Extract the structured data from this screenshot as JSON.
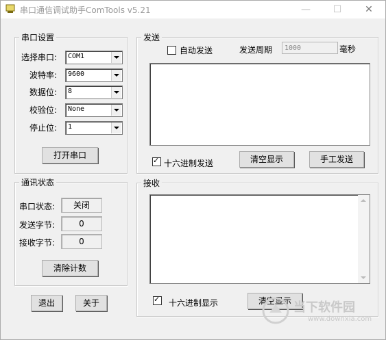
{
  "window": {
    "title": "串口通信调试助手ComTools v5.21"
  },
  "serial": {
    "title": "串口设置",
    "port": {
      "label": "选择串口:",
      "value": "COM1"
    },
    "baud": {
      "label": "波特率:",
      "value": "9600"
    },
    "databits": {
      "label": "数据位:",
      "value": "8"
    },
    "parity": {
      "label": "校验位:",
      "value": "None"
    },
    "stopbits": {
      "label": "停止位:",
      "value": "1"
    },
    "open_label": "打开串口"
  },
  "status": {
    "title": "通讯状态",
    "port_label": "串口状态:",
    "port_value": "关闭",
    "sent_label": "发送字节:",
    "sent_value": "0",
    "recv_label": "接收字节:",
    "recv_value": "0",
    "clear_label": "清除计数"
  },
  "send": {
    "title": "发送",
    "auto_label": "自动发送",
    "period_label": "发送周期",
    "period_value": "1000",
    "period_unit": "毫秒",
    "hex_label": "十六进制发送",
    "clear_label": "清空显示",
    "send_label": "手工发送"
  },
  "recv": {
    "title": "接收",
    "hex_label": "十六进制显示",
    "clear_label": "清空显示"
  },
  "bottom": {
    "exit_label": "退出",
    "about_label": "关于"
  },
  "watermark": {
    "text": "当下软件园",
    "url": "www.downxia.com"
  }
}
